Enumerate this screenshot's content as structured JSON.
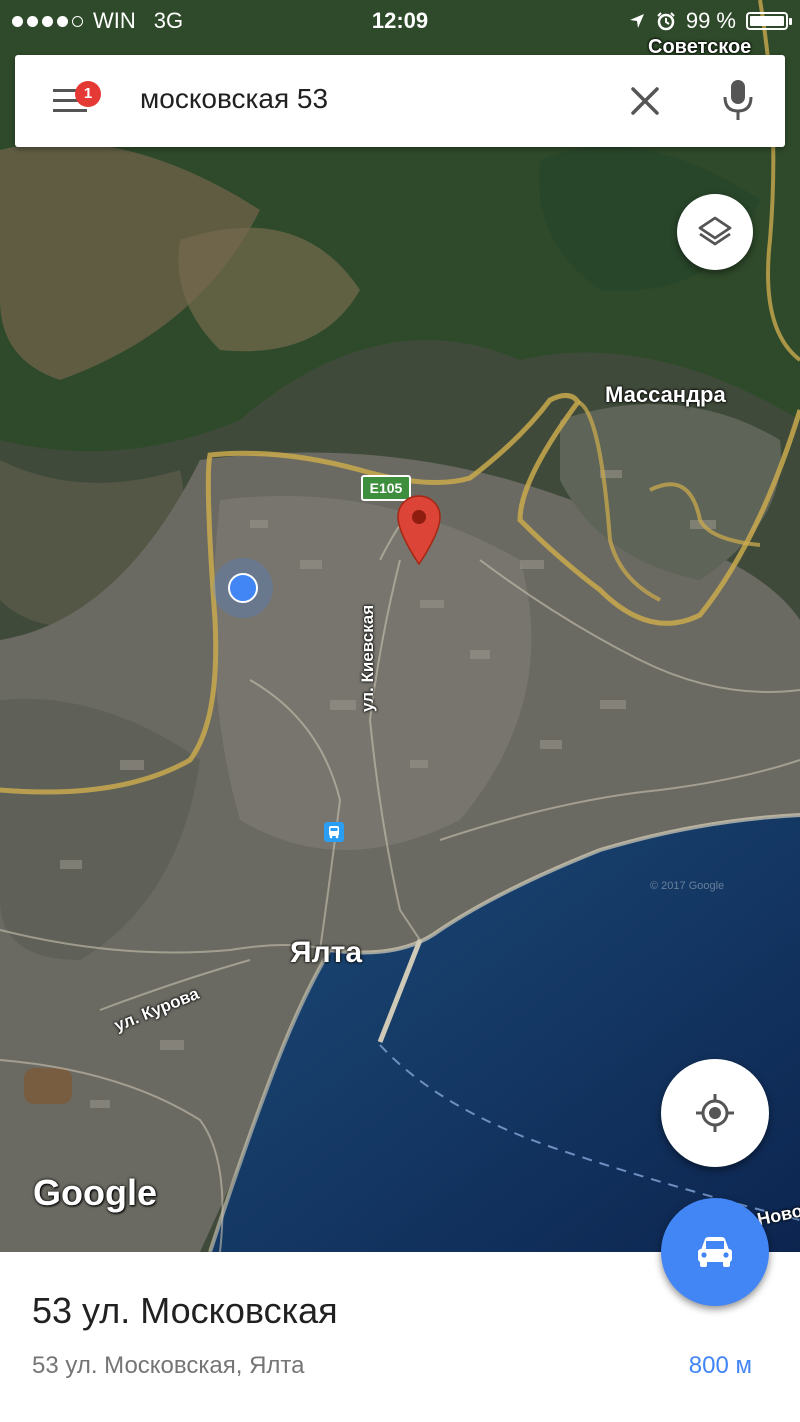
{
  "status_bar": {
    "carrier": "WIN",
    "network": "3G",
    "time": "12:09",
    "battery": "99 %",
    "battery_level": 0.99
  },
  "search": {
    "query": "московская 53",
    "notification_count": "1",
    "menu_icon": "hamburger-menu-icon",
    "clear_icon": "close-icon",
    "voice_icon": "microphone-icon"
  },
  "map": {
    "labels": {
      "sovetskoe": "Советское",
      "massandra": "Массандра",
      "yalta": "Ялта",
      "kievskaya": "ул. Киевская",
      "kurova": "ул. Курова",
      "novo": "Ново",
      "e105": "E105"
    },
    "watermark": "Google",
    "copyright": "© 2017 Google"
  },
  "controls": {
    "layers_icon": "layers-icon",
    "locate_icon": "my-location-icon",
    "directions_icon": "car-icon"
  },
  "place": {
    "title": "53 ул. Московская",
    "address": "53 ул. Московская, Ялта",
    "distance": "800 м"
  },
  "colors": {
    "accent": "#4285f4",
    "pin": "#db4437",
    "badge": "#e53935",
    "road": "#c9a94e",
    "sea": "#0f2a52"
  }
}
